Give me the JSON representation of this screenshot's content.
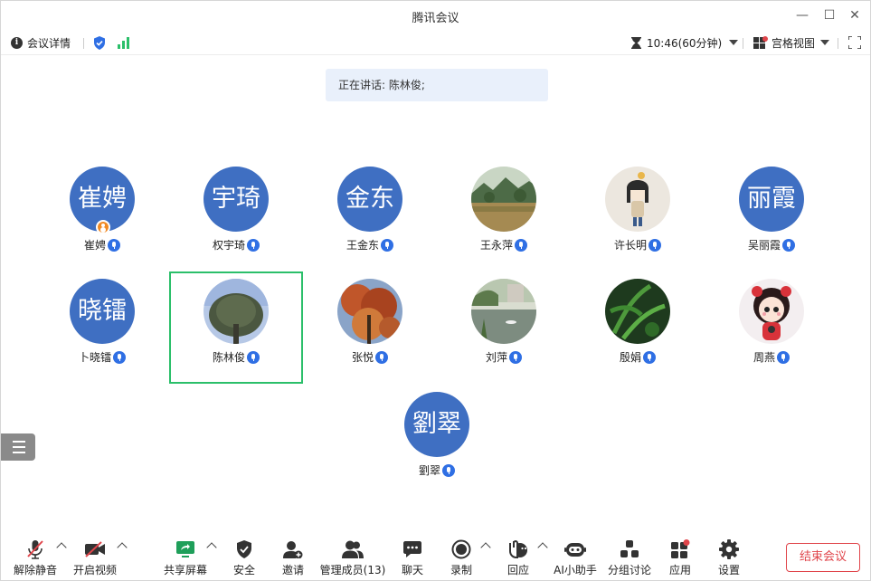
{
  "window": {
    "title": "腾讯会议",
    "minimize": "—",
    "maximize": "☐",
    "close": "✕"
  },
  "topbar": {
    "meeting_details": "会议详情",
    "timer": "10:46(60分钟)",
    "view_mode": "宫格视图"
  },
  "speaking": "正在讲话: 陈林俊;",
  "participants": [
    {
      "name": "崔娉",
      "avatar_text": "崔娉",
      "host": true
    },
    {
      "name": "权宇琦",
      "avatar_text": "宇琦"
    },
    {
      "name": "王金东",
      "avatar_text": "金东"
    },
    {
      "name": "王永萍",
      "avatar_text": "",
      "avatar_icon": "landscape-photo-avatar"
    },
    {
      "name": "许长明",
      "avatar_text": "",
      "avatar_icon": "cartoon-girl-avatar"
    },
    {
      "name": "吴丽霞",
      "avatar_text": "丽霞"
    },
    {
      "name": "卜晓镭",
      "avatar_text": "晓镭"
    },
    {
      "name": "陈林俊",
      "avatar_text": "",
      "avatar_icon": "tree-sky-photo-avatar",
      "active_speaker": true
    },
    {
      "name": "张悦",
      "avatar_text": "",
      "avatar_icon": "autumn-tree-photo-avatar"
    },
    {
      "name": "刘萍",
      "avatar_text": "",
      "avatar_icon": "pond-photo-avatar"
    },
    {
      "name": "殷娟",
      "avatar_text": "",
      "avatar_icon": "fern-photo-avatar"
    },
    {
      "name": "周燕",
      "avatar_text": "",
      "avatar_icon": "cartoon-doll-avatar"
    },
    {
      "name": "劉翠",
      "avatar_text": "劉翠"
    }
  ],
  "toolbar": {
    "unmute": "解除静音",
    "start_video": "开启视频",
    "share_screen": "共享屏幕",
    "security": "安全",
    "invite": "邀请",
    "manage_members": "管理成员(13)",
    "chat": "聊天",
    "record": "录制",
    "reactions": "回应",
    "ai_assistant": "AI小助手",
    "breakout": "分组讨论",
    "apps": "应用",
    "settings": "设置",
    "end_meeting": "结束会议"
  },
  "colors": {
    "avatar_blue": "#3f6fc2",
    "active_border": "#2bbf6a",
    "end_red": "#e0454b",
    "mic_blue": "#2f6fe4",
    "host_orange": "#f08a24"
  }
}
